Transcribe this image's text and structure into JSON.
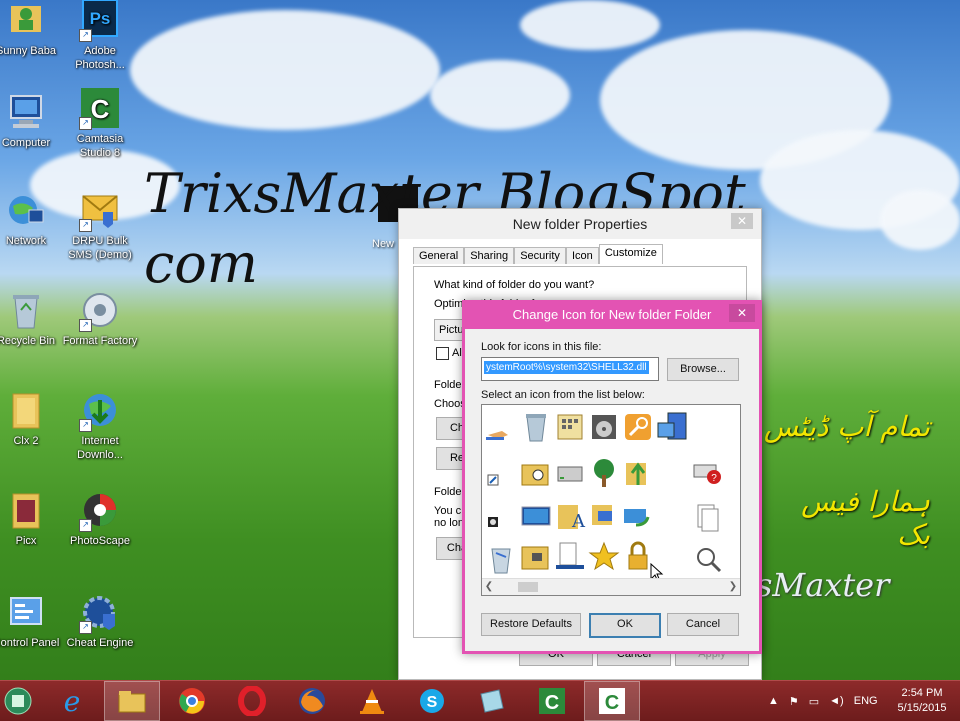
{
  "desktop": {
    "icons": [
      {
        "label": "Sunny Baba"
      },
      {
        "label": "Adobe Photosh..."
      },
      {
        "label": "Computer"
      },
      {
        "label": "Camtasia Studio 8"
      },
      {
        "label": "Network"
      },
      {
        "label": "DRPU Bulk SMS (Demo)"
      },
      {
        "label": "Recycle Bin"
      },
      {
        "label": "Format Factory"
      },
      {
        "label": "Clx 2"
      },
      {
        "label": "Internet Downlo..."
      },
      {
        "label": "Picx"
      },
      {
        "label": "PhotoScape"
      },
      {
        "label": "Control Panel"
      },
      {
        "label": "Cheat Engine"
      }
    ],
    "new_folder_label": "New",
    "watermark_line1": "TrixsMaxter BlogSpot",
    "watermark_line2": "com",
    "urdu_line1": "تمام آپ ڈیٹس",
    "urdu_line2": "ہمارا فیس بک",
    "watermark_small": "sMaxter"
  },
  "properties_dialog": {
    "title": "New folder Properties",
    "close": "✕",
    "tabs": [
      "General",
      "Sharing",
      "Security",
      "Icon",
      "Customize"
    ],
    "active_tab": "Customize",
    "question": "What kind of folder do you want?",
    "optimize_label": "Optimize this folder for:",
    "optimize_value": "Pictur",
    "also_label": "Als",
    "folder_pictures_label": "Folder",
    "choose_label": "Choos",
    "choose_button": "Ch",
    "restore_button": "Re",
    "folder_icons_label": "Folder",
    "folder_icons_text1": "You c",
    "folder_icons_text2": "no lon",
    "change_button": "Cha",
    "ok": "OK",
    "cancel": "Cancel",
    "apply": "Apply"
  },
  "change_icon_dialog": {
    "title": "Change Icon for New folder Folder",
    "close": "✕",
    "look_label": "Look for icons in this file:",
    "path_value": "ystemRoot%\\system32\\SHELL32.dll",
    "browse_button": "Browse...",
    "select_label": "Select an icon from the list below:",
    "restore_defaults": "Restore Defaults",
    "ok": "OK",
    "cancel": "Cancel"
  },
  "taskbar": {
    "language": "ENG",
    "time": "2:54 PM",
    "date": "5/15/2015"
  }
}
